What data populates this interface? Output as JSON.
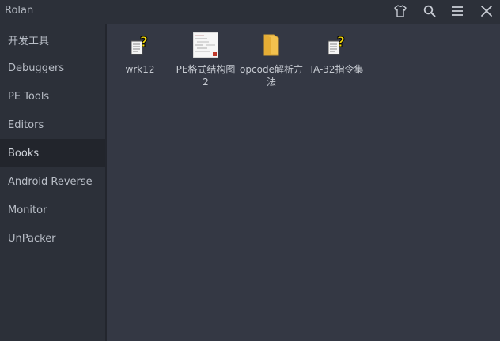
{
  "window": {
    "title": "Rolan",
    "controls": [
      "shirt-icon",
      "search-icon",
      "menu-icon",
      "close-icon"
    ]
  },
  "sidebar": {
    "items": [
      {
        "label": "开发工具"
      },
      {
        "label": "Debuggers"
      },
      {
        "label": "PE Tools"
      },
      {
        "label": "Editors"
      },
      {
        "label": "Books",
        "active": true
      },
      {
        "label": "Android Reverse"
      },
      {
        "label": "Monitor"
      },
      {
        "label": "UnPacker"
      }
    ]
  },
  "main": {
    "files": [
      {
        "label": "wrk12",
        "icon": "help-file-icon"
      },
      {
        "label": "PE格式结构图2",
        "icon": "image-thumbnail-icon"
      },
      {
        "label": "opcode解析方法",
        "icon": "folder-icon"
      },
      {
        "label": "IA-32指令集",
        "icon": "help-file-icon"
      }
    ]
  },
  "colors": {
    "background": "#343844",
    "sidebar": "#2c3039",
    "active_item": "#22252c",
    "folder": "#f2c14e",
    "help_question": "#f5d90a"
  }
}
